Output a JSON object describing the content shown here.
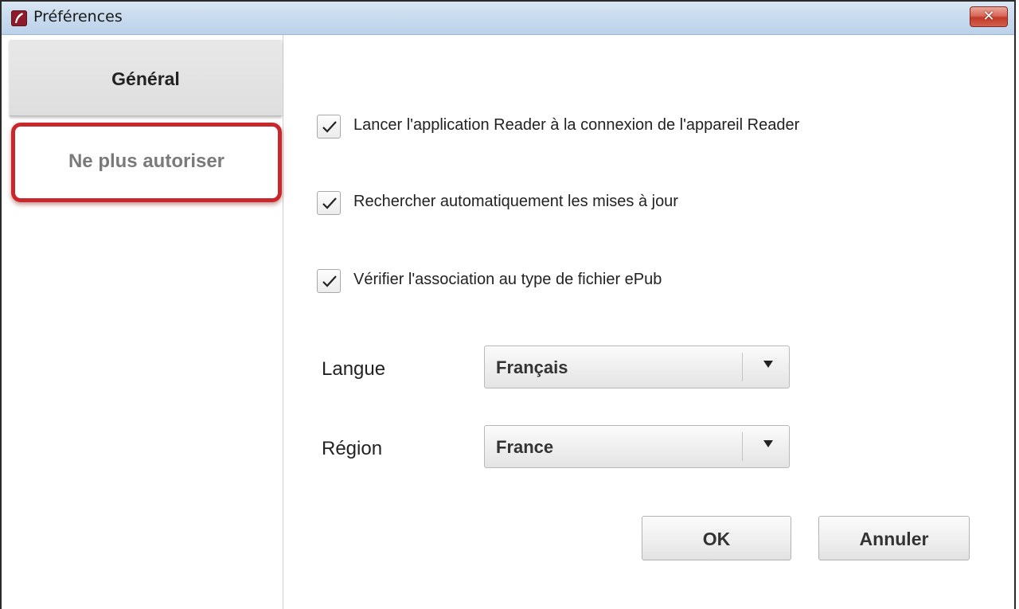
{
  "window": {
    "title": "Préférences",
    "app_icon": "reader-feather-icon",
    "close_icon": "close-icon",
    "close_glyph": "✕"
  },
  "sidebar": {
    "items": [
      {
        "label": "Général",
        "selected": true
      },
      {
        "label": "Ne plus autoriser",
        "selected": false,
        "highlighted": true
      }
    ]
  },
  "general": {
    "options": [
      {
        "label": "Lancer l'application Reader à la connexion de l'appareil Reader",
        "checked": true
      },
      {
        "label": "Rechercher automatiquement les mises à jour",
        "checked": true
      },
      {
        "label": "Vérifier l'association au type de fichier ePub",
        "checked": true
      }
    ],
    "language": {
      "label": "Langue",
      "value": "Français"
    },
    "region": {
      "label": "Région",
      "value": "France"
    }
  },
  "buttons": {
    "ok": "OK",
    "cancel": "Annuler"
  },
  "colors": {
    "highlight_border": "#c8282b",
    "close_button": "#c23a28",
    "titlebar": "#c9dbee"
  }
}
